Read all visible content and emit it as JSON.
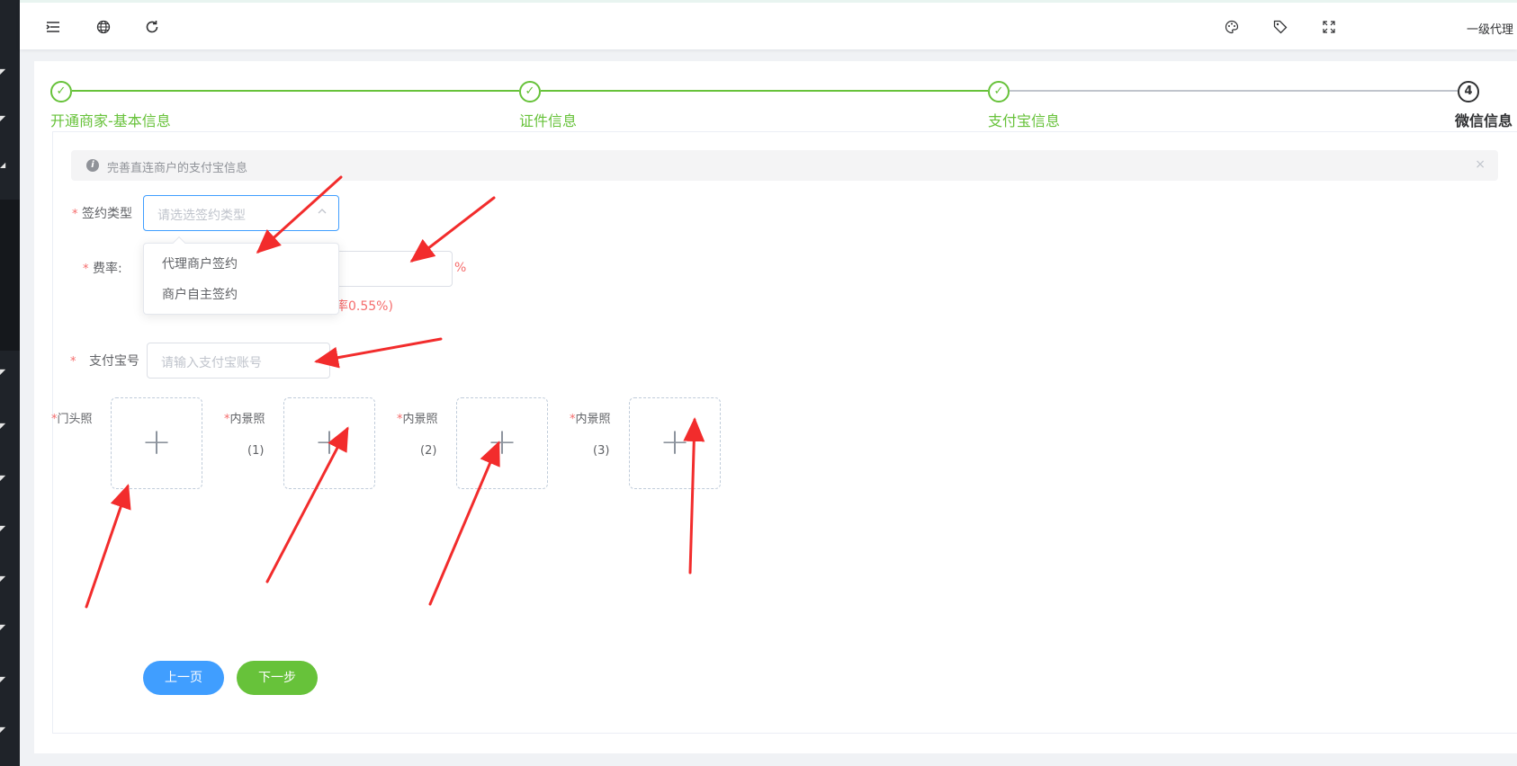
{
  "header": {
    "user_label": "一级代理",
    "icons": [
      "menu-fold-icon",
      "globe-icon",
      "refresh-icon",
      "palette-icon",
      "tag-icon",
      "fullscreen-icon"
    ]
  },
  "steps": [
    {
      "title": "开通商家-基本信息",
      "status": "finish",
      "marker": "✓"
    },
    {
      "title": "证件信息",
      "status": "finish",
      "marker": "✓"
    },
    {
      "title": "支付宝信息",
      "status": "finish",
      "marker": "✓"
    },
    {
      "title": "微信信息",
      "status": "process",
      "marker": "4"
    }
  ],
  "alert": {
    "text": "完善直连商户的支付宝信息",
    "close": "×"
  },
  "form": {
    "required_mark": "*",
    "sign_type": {
      "label": "签约类型",
      "placeholder": "请选选签约类型",
      "options": [
        "代理商户签约",
        "商户自主签约"
      ]
    },
    "rate": {
      "label": "费率:",
      "unit": "%",
      "hint": "率0.55%)"
    },
    "alipay_account": {
      "label": "支付宝号",
      "placeholder": "请输入支付宝账号"
    },
    "uploads": [
      {
        "label": "门头照",
        "sub": ""
      },
      {
        "label": "内景照",
        "sub": "(1)"
      },
      {
        "label": "内景照",
        "sub": "(2)"
      },
      {
        "label": "内景照",
        "sub": "(3)"
      }
    ],
    "upload_plus": "+"
  },
  "buttons": {
    "prev": "上一页",
    "next": "下一步"
  },
  "colors": {
    "success": "#67c23a",
    "primary": "#409eff",
    "danger": "#f56c6c",
    "annotation_arrow": "#f22c2c"
  }
}
